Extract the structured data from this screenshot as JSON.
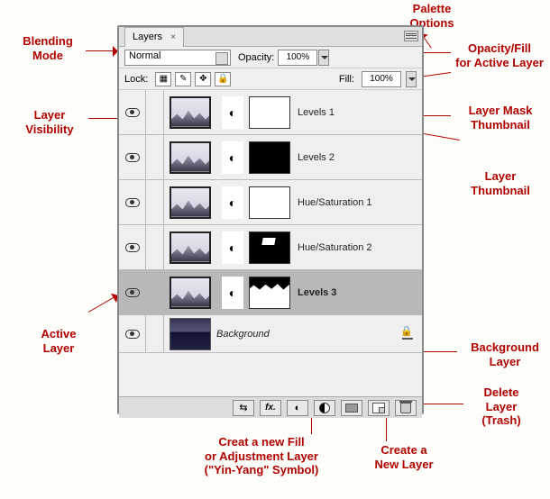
{
  "panel": {
    "tab_label": "Layers",
    "opacity_label": "Opacity:",
    "opacity_value": "100%",
    "fill_label": "Fill:",
    "fill_value": "100%",
    "lock_label": "Lock:",
    "blend_mode": "Normal"
  },
  "layers": [
    {
      "name": "Levels 1",
      "mask": "white",
      "active": false
    },
    {
      "name": "Levels 2",
      "mask": "black",
      "active": false
    },
    {
      "name": "Hue/Saturation 1",
      "mask": "white",
      "active": false
    },
    {
      "name": "Hue/Saturation 2",
      "mask": "mixed",
      "active": false
    },
    {
      "name": "Levels 3",
      "mask": "torn",
      "active": true
    },
    {
      "name": "Background",
      "mask": "none",
      "active": false,
      "locked": true,
      "bg": true
    }
  ],
  "annotations": {
    "blending_mode": "Blending\nMode",
    "palette_options": "Palette\nOptions",
    "opacity_fill": "Opacity/Fill\nfor Active Layer",
    "layer_visibility": "Layer\nVisibility",
    "layer_mask_thumb": "Layer Mask\nThumbnail",
    "layer_thumb": "Layer\nThumbnail",
    "active_layer": "Active\nLayer",
    "background_layer": "Background\nLayer",
    "delete_layer": "Delete\nLayer\n(Trash)",
    "create_new_layer": "Create a\nNew Layer",
    "create_fill": "Creat a new Fill\nor Adjustment Layer\n(\"Yin-Yang\" Symbol)"
  }
}
